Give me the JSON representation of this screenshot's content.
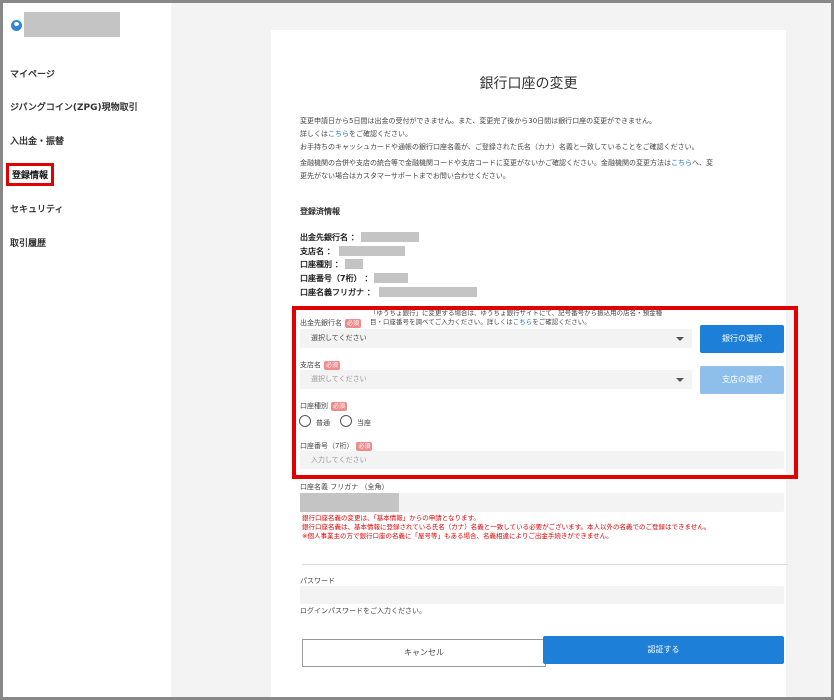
{
  "sidebar": {
    "items": [
      {
        "label": "マイページ"
      },
      {
        "label": "ジパングコイン(ZPG)現物取引"
      },
      {
        "label": "入出金・振替"
      },
      {
        "label": "登録情報"
      },
      {
        "label": "セキュリティ"
      },
      {
        "label": "取引履歴"
      }
    ]
  },
  "page": {
    "title": "銀行口座の変更",
    "notes": {
      "line1": "変更申請日から5日間は出金の受付ができません。また、変更完了後から30日間は銀行口座の変更ができません。",
      "line2a": "詳しくは",
      "line2_link": "こちら",
      "line2b": "をご確認ください。",
      "line3": "お手持ちのキャッシュカードや通帳の銀行口座名義が、ご登録された氏名（カナ）名義と一致していることをご確認ください。",
      "line4a": "金融機関の合併や支店の統合等で金融機関コードや支店コードに変更がないかご確認ください。金融機関の変更方法は",
      "line4_link": "こちら",
      "line4b": "へ、変",
      "line5": "更先がない場合はカスタマーサポートまでお問い合わせください。"
    }
  },
  "registered": {
    "title": "登録済情報",
    "bank_name": "出金先銀行名 ：",
    "branch": "支店名 ：",
    "account_type": "口座種別 ：",
    "account_number": "口座番号（7桁） ：",
    "account_holder": "口座名義フリガナ ："
  },
  "form": {
    "required": "必須",
    "bank_label": "出金先銀行名",
    "bank_note_1": "「ゆうちょ銀行」に変更する場合は、ゆうちょ銀行サイトにて、記号番号から振込用の店名・預金種",
    "bank_note_2a": "目・口座番号を調べてご入力ください。詳しくは",
    "bank_note_link": "こちら",
    "bank_note_2b": "をご確認ください。",
    "bank_select": "選択してください",
    "bank_button": "銀行の選択",
    "branch_label": "支店名",
    "branch_select": "選択してください",
    "branch_button": "支店の選択",
    "type_label": "口座種別",
    "type_options": [
      "普通",
      "当座"
    ],
    "number_label": "口座番号（7桁）",
    "number_placeholder": "入力してください",
    "holder_label": "口座名義 フリガナ （全角）",
    "warnings": [
      "銀行口座名義の変更は、「基本情報」からの申請となります。",
      "銀行口座名義は、基本情報に登録されている氏名（カナ）名義と一致している必要がございます。本人以外の名義でのご登録はできません。",
      "※個人事業主の方で銀行口座の名義に「屋号等」もある場合、名義相違によりご出金手続きができません。"
    ],
    "password_label": "パスワード",
    "password_hint": "ログインパスワードをご入力ください。",
    "cancel": "キャンセル",
    "submit": "認証する"
  },
  "colors": {
    "primary": "#1e7fd9",
    "highlight": "#e00000",
    "required_badge": "#f18b8b"
  }
}
